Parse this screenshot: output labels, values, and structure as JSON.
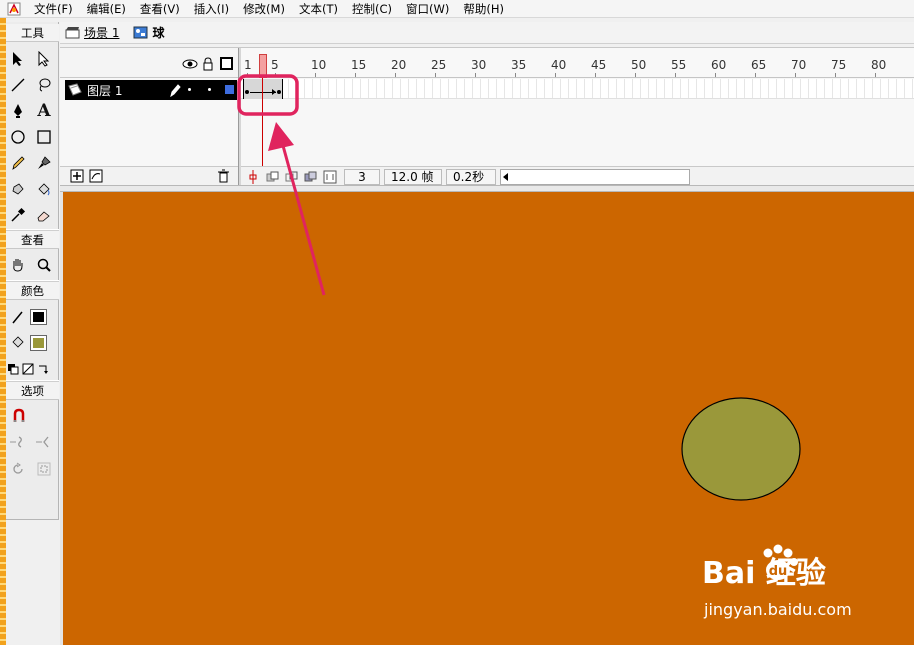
{
  "menu": {
    "items": [
      "文件(F)",
      "编辑(E)",
      "查看(V)",
      "插入(I)",
      "修改(M)",
      "文本(T)",
      "控制(C)",
      "窗口(W)",
      "帮助(H)"
    ]
  },
  "toolbox": {
    "tools_header": "工具",
    "view_header": "查看",
    "colors_header": "颜色",
    "options_header": "选项",
    "stroke_color": "#000000",
    "fill_color": "#9a983a"
  },
  "scene": {
    "scene_label": "场景 1",
    "symbol_label": "球"
  },
  "timeline": {
    "layer_name": "图层 1",
    "ruler_numbers": [
      "1",
      "5",
      "10",
      "15",
      "20",
      "25",
      "30",
      "35",
      "40",
      "45",
      "50",
      "55",
      "60",
      "65",
      "70",
      "75",
      "80"
    ],
    "current_frame": "3",
    "frame_rate": "12.0 帧",
    "elapsed_time": "0.2秒"
  },
  "stage": {
    "background_color": "#cc6600",
    "ball_color": "#9a983a"
  },
  "annotation": {
    "color": "#e0245e"
  },
  "watermark": {
    "brand": "Bai  经验",
    "url": "jingyan.baidu.com"
  }
}
